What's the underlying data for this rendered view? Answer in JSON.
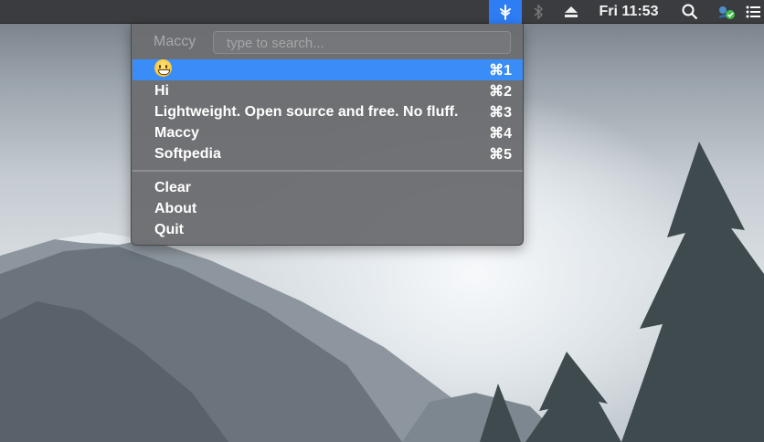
{
  "menubar": {
    "clock": "Fri 11:53",
    "icons": [
      "maccy-icon",
      "bluetooth-icon",
      "eject-icon",
      "spotlight-search-icon",
      "user-status-icon",
      "notification-list-icon"
    ]
  },
  "menu": {
    "app_label": "Maccy",
    "search_placeholder": "type to search...",
    "search_value": "",
    "history": [
      {
        "label": "😀",
        "shortcut": "⌘1",
        "selected": true
      },
      {
        "label": "Hi",
        "shortcut": "⌘2"
      },
      {
        "label": "Lightweight. Open source and free. No fluff.",
        "shortcut": "⌘3"
      },
      {
        "label": "Maccy",
        "shortcut": "⌘4"
      },
      {
        "label": "Softpedia",
        "shortcut": "⌘5"
      }
    ],
    "actions": {
      "clear": "Clear",
      "about": "About",
      "quit": "Quit"
    }
  },
  "colors": {
    "highlight": "#3a8cf7",
    "menubar": "#3b3c3f",
    "menu_bg": "#6c6d70"
  }
}
